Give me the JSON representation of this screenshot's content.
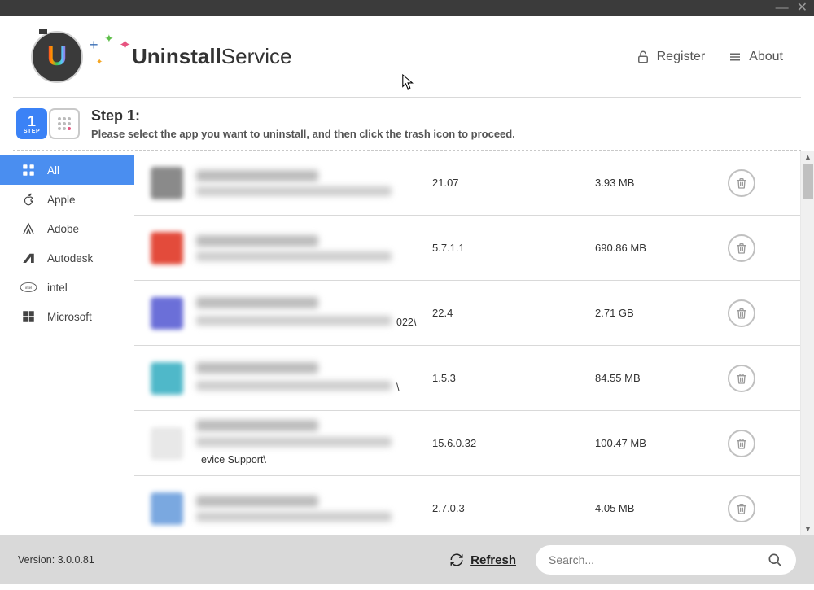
{
  "brand": {
    "strong": "Uninstall",
    "light": "Service"
  },
  "header": {
    "register": "Register",
    "about": "About"
  },
  "step": {
    "badge_num": "1",
    "badge_label": "STEP",
    "title": "Step 1:",
    "subtitle": "Please select the app you want to uninstall, and then click the trash icon to proceed."
  },
  "sidebar": {
    "items": [
      {
        "label": "All",
        "icon": "grid-icon",
        "selected": true
      },
      {
        "label": "Apple",
        "icon": "apple-icon",
        "selected": false
      },
      {
        "label": "Adobe",
        "icon": "adobe-icon",
        "selected": false
      },
      {
        "label": "Autodesk",
        "icon": "autodesk-icon",
        "selected": false
      },
      {
        "label": "intel",
        "icon": "intel-icon",
        "selected": false
      },
      {
        "label": "Microsoft",
        "icon": "microsoft-icon",
        "selected": false
      }
    ]
  },
  "apps": [
    {
      "icon_color": "#8a8a8a",
      "path_tail": "",
      "version": "21.07",
      "size": "3.93 MB"
    },
    {
      "icon_color": "#e34b3b",
      "path_tail": "",
      "version": "5.7.1.1",
      "size": "690.86 MB"
    },
    {
      "icon_color": "#6b6fd8",
      "path_tail": "022\\",
      "version": "22.4",
      "size": "2.71 GB"
    },
    {
      "icon_color": "#4fb8c9",
      "path_tail": "\\",
      "version": "1.5.3",
      "size": "84.55 MB"
    },
    {
      "icon_color": "#e8e8e8",
      "path_tail": "evice Support\\",
      "version": "15.6.0.32",
      "size": "100.47 MB"
    },
    {
      "icon_color": "#7aa8e0",
      "path_tail": "",
      "version": "2.7.0.3",
      "size": "4.05 MB"
    }
  ],
  "footer": {
    "version_label": "Version: 3.0.0.81",
    "refresh": "Refresh",
    "search_placeholder": "Search..."
  }
}
